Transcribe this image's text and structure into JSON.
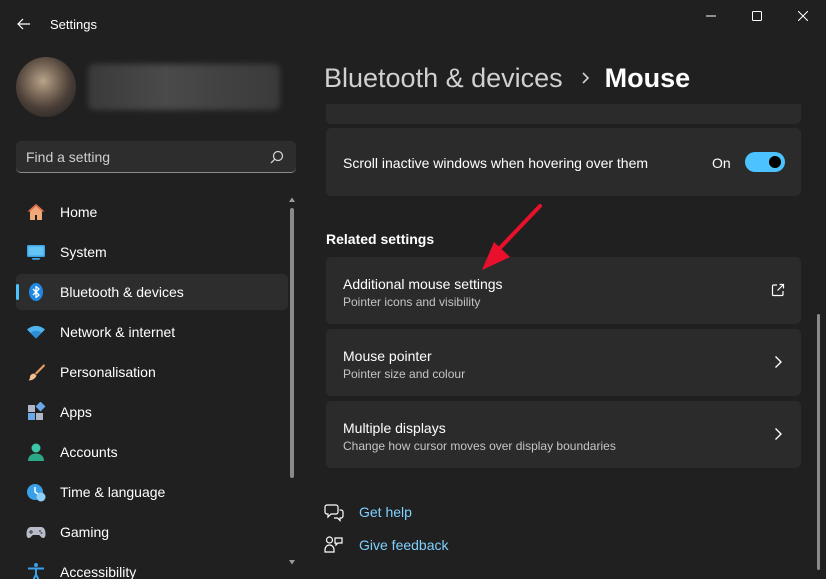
{
  "window": {
    "title": "Settings"
  },
  "search": {
    "placeholder": "Find a setting"
  },
  "sidebar": {
    "items": [
      {
        "label": "Home",
        "icon": "home-icon",
        "active": false
      },
      {
        "label": "System",
        "icon": "system-icon",
        "active": false
      },
      {
        "label": "Bluetooth & devices",
        "icon": "bluetooth-icon",
        "active": true
      },
      {
        "label": "Network & internet",
        "icon": "network-icon",
        "active": false
      },
      {
        "label": "Personalisation",
        "icon": "brush-icon",
        "active": false
      },
      {
        "label": "Apps",
        "icon": "apps-icon",
        "active": false
      },
      {
        "label": "Accounts",
        "icon": "accounts-icon",
        "active": false
      },
      {
        "label": "Time & language",
        "icon": "time-language-icon",
        "active": false
      },
      {
        "label": "Gaming",
        "icon": "gaming-icon",
        "active": false
      },
      {
        "label": "Accessibility",
        "icon": "accessibility-icon",
        "active": false
      }
    ]
  },
  "breadcrumb": {
    "parent": "Bluetooth & devices",
    "current": "Mouse"
  },
  "scroll_setting": {
    "title": "Scroll inactive windows when hovering over them",
    "state": "On"
  },
  "related": {
    "heading": "Related settings",
    "items": [
      {
        "title": "Additional mouse settings",
        "subtitle": "Pointer icons and visibility",
        "action": "external-link-icon"
      },
      {
        "title": "Mouse pointer",
        "subtitle": "Pointer size and colour",
        "action": "chevron-right-icon"
      },
      {
        "title": "Multiple displays",
        "subtitle": "Change how cursor moves over display boundaries",
        "action": "chevron-right-icon"
      }
    ]
  },
  "footer": {
    "help": "Get help",
    "feedback": "Give feedback"
  },
  "colors": {
    "accent": "#4cc2ff",
    "background": "#202020",
    "card": "#2b2b2b",
    "annotation_arrow": "#e8102b"
  }
}
